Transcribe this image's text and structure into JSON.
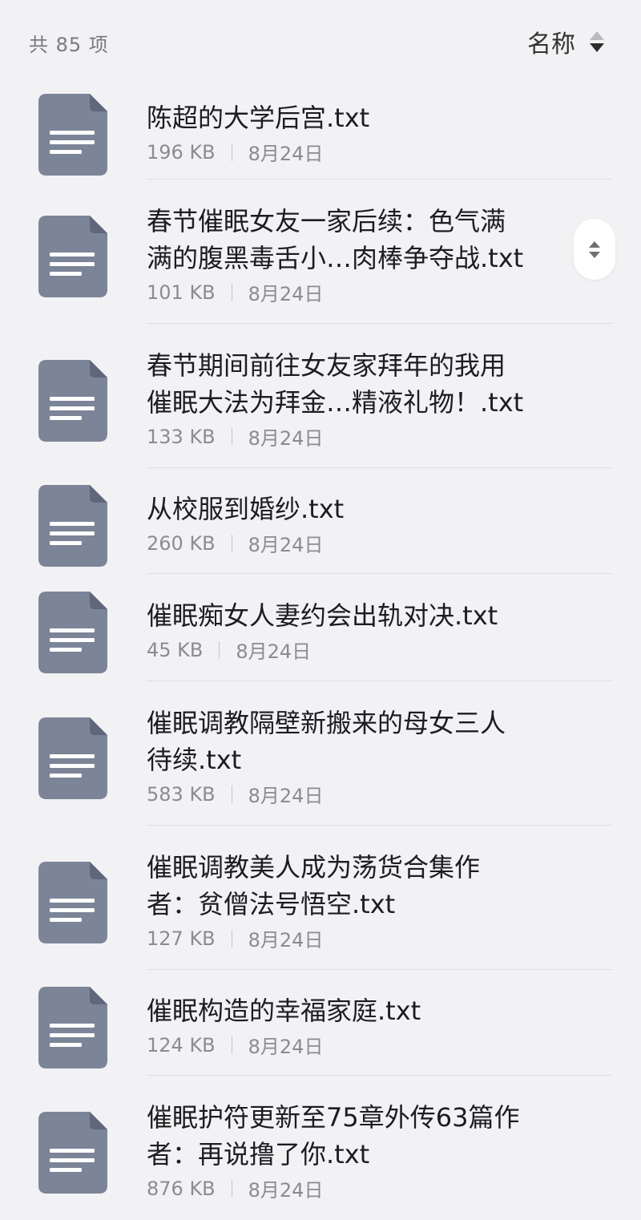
{
  "header": {
    "count_label": "共 85 项",
    "sort_label": "名称"
  },
  "files": [
    {
      "title_lines": [
        "陈超的大学后宫.txt"
      ],
      "size": "196 KB",
      "date": "8月24日"
    },
    {
      "title_lines": [
        "春节催眠女友一家后续：色气满",
        "满的腹黑毒舌小…肉棒争夺战.txt"
      ],
      "size": "101 KB",
      "date": "8月24日"
    },
    {
      "title_lines": [
        "春节期间前往女友家拜年的我用",
        "催眠大法为拜金…精液礼物！.txt"
      ],
      "size": "133 KB",
      "date": "8月24日"
    },
    {
      "title_lines": [
        "从校服到婚纱.txt"
      ],
      "size": "260 KB",
      "date": "8月24日"
    },
    {
      "title_lines": [
        "催眠痴女人妻约会出轨对决.txt"
      ],
      "size": "45 KB",
      "date": "8月24日"
    },
    {
      "title_lines": [
        "催眠调教隔壁新搬来的母女三人",
        "待续.txt"
      ],
      "size": "583 KB",
      "date": "8月24日"
    },
    {
      "title_lines": [
        "催眠调教美人成为荡货合集作",
        "者：贫僧法号悟空.txt"
      ],
      "size": "127 KB",
      "date": "8月24日"
    },
    {
      "title_lines": [
        "催眠构造的幸福家庭.txt"
      ],
      "size": "124 KB",
      "date": "8月24日"
    },
    {
      "title_lines": [
        "催眠护符更新至75章外传63篇作",
        "者：再说撸了你.txt"
      ],
      "size": "876 KB",
      "date": "8月24日"
    }
  ],
  "icons": {
    "file": "document-icon",
    "sort": "sort-arrows-icon",
    "scroll": "fast-scroll-handle-icon"
  },
  "colors": {
    "background": "#f2f2f4",
    "file_icon": "#7c8497",
    "title_text": "#1d1d1f",
    "meta_text": "#8a8c92"
  }
}
